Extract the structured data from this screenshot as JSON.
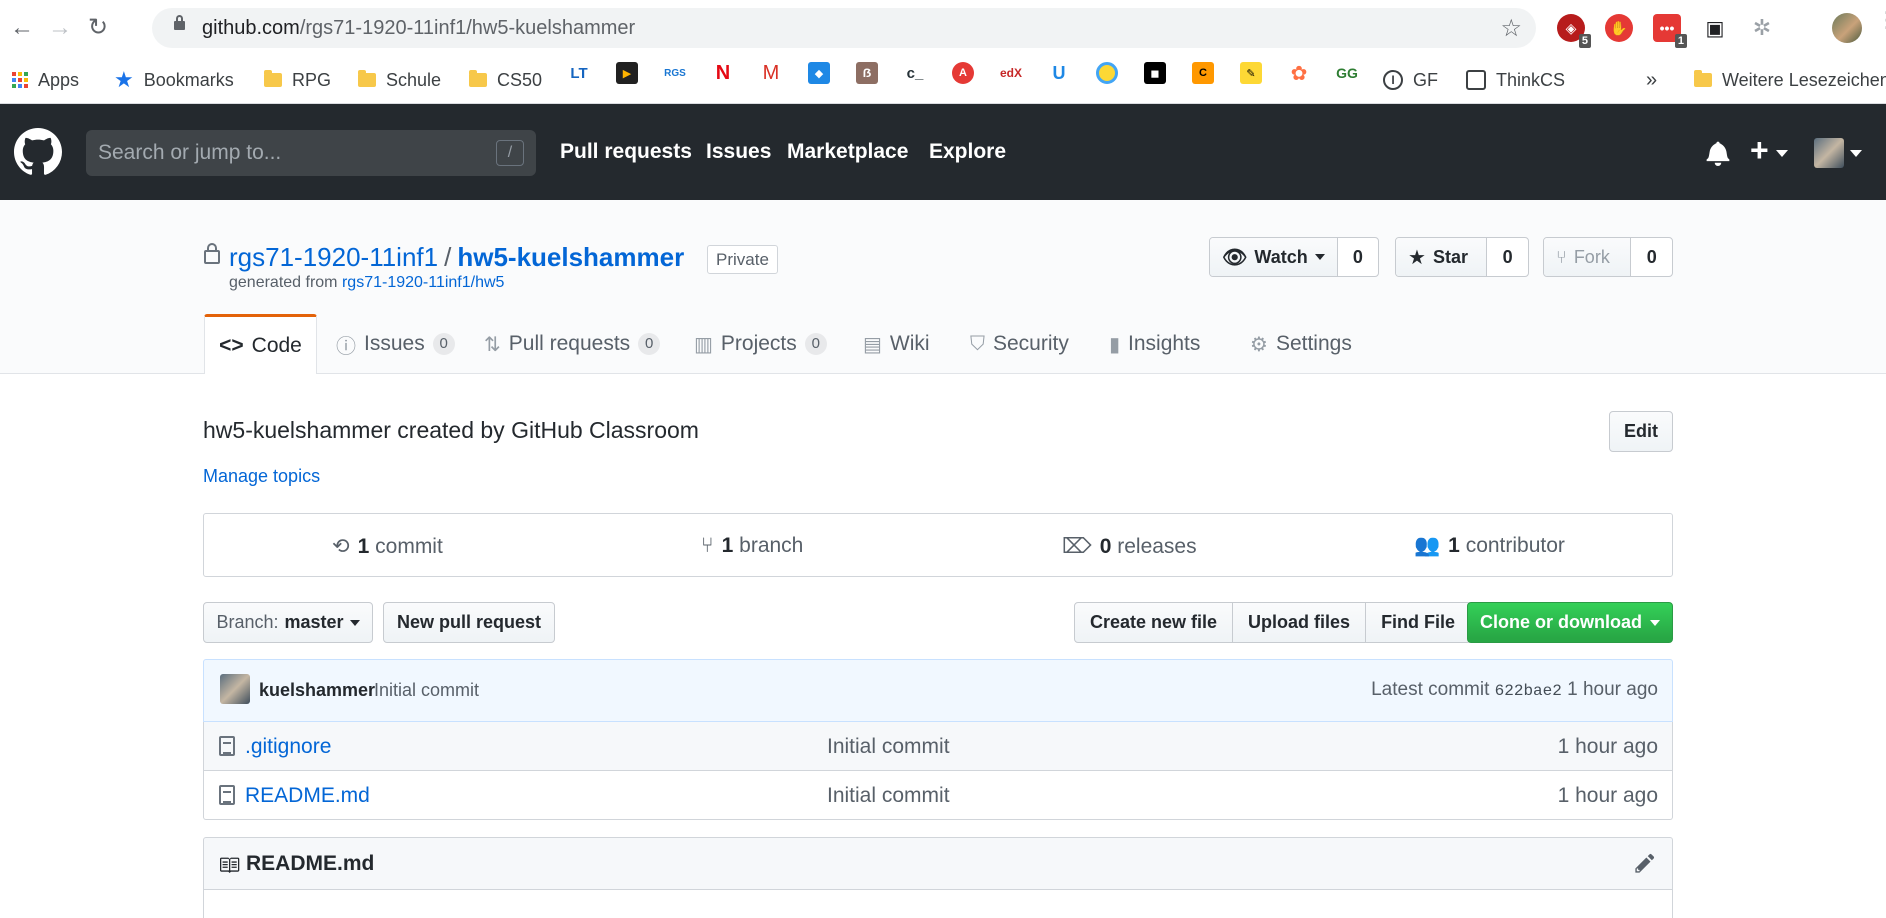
{
  "browser": {
    "url_host": "github.com",
    "url_path": "/rgs71-1920-11inf1/hw5-kuelshammer",
    "extension_badges": [
      "5",
      "1"
    ],
    "bookmarks": [
      {
        "label": "Apps",
        "icon": "apps-grid-icon"
      },
      {
        "label": "Bookmarks",
        "icon": "star-icon"
      },
      {
        "label": "RPG",
        "icon": "folder-icon"
      },
      {
        "label": "Schule",
        "icon": "folder-icon"
      },
      {
        "label": "CS50",
        "icon": "folder-icon"
      },
      {
        "label": "GF",
        "icon": "site-icon"
      },
      {
        "label": "ThinkCS",
        "icon": "site-icon"
      },
      {
        "label": "Weitere Lesezeichen",
        "icon": "folder-icon"
      }
    ],
    "overflow_label": "»",
    "favicon_labels": [
      "LT",
      "RGS",
      "M",
      "ẞ",
      "c_",
      "edX",
      "U",
      "GG"
    ]
  },
  "github": {
    "search_placeholder": "Search or jump to...",
    "search_shortcut": "/",
    "nav": [
      "Pull requests",
      "Issues",
      "Marketplace",
      "Explore"
    ]
  },
  "repo": {
    "owner": "rgs71-1920-11inf1",
    "separator": "/",
    "name": "hw5-kuelshammer",
    "visibility": "Private",
    "generated_prefix": "generated from",
    "generated_from": "rgs71-1920-11inf1/hw5",
    "watch": {
      "label": "Watch",
      "count": "0"
    },
    "star": {
      "label": "Star",
      "count": "0"
    },
    "fork": {
      "label": "Fork",
      "count": "0"
    },
    "tabs": [
      {
        "label": "Code",
        "count": null
      },
      {
        "label": "Issues",
        "count": "0"
      },
      {
        "label": "Pull requests",
        "count": "0"
      },
      {
        "label": "Projects",
        "count": "0"
      },
      {
        "label": "Wiki",
        "count": null
      },
      {
        "label": "Security",
        "count": null
      },
      {
        "label": "Insights",
        "count": null
      },
      {
        "label": "Settings",
        "count": null
      }
    ],
    "description": "hw5-kuelshammer created by GitHub Classroom",
    "edit_label": "Edit",
    "manage_topics": "Manage topics",
    "summary": [
      {
        "count": "1",
        "label": "commit"
      },
      {
        "count": "1",
        "label": "branch"
      },
      {
        "count": "0",
        "label": "releases"
      },
      {
        "count": "1",
        "label": "contributor"
      }
    ],
    "branch_prefix": "Branch:",
    "branch_name": "master",
    "new_pr": "New pull request",
    "file_buttons": [
      "Create new file",
      "Upload files",
      "Find File"
    ],
    "clone_label": "Clone or download",
    "latest_commit": {
      "author": "kuelshammer",
      "message": "Initial commit",
      "prefix": "Latest commit",
      "sha": "622bae2",
      "age": "1 hour ago"
    },
    "files": [
      {
        "name": ".gitignore",
        "message": "Initial commit",
        "age": "1 hour ago"
      },
      {
        "name": "README.md",
        "message": "Initial commit",
        "age": "1 hour ago"
      }
    ],
    "readme_title": "README.md"
  },
  "colors": {
    "header_bg": "#24292e",
    "link": "#0366d6",
    "clone_green": "#28a745",
    "active_tab_accent": "#e36209"
  }
}
